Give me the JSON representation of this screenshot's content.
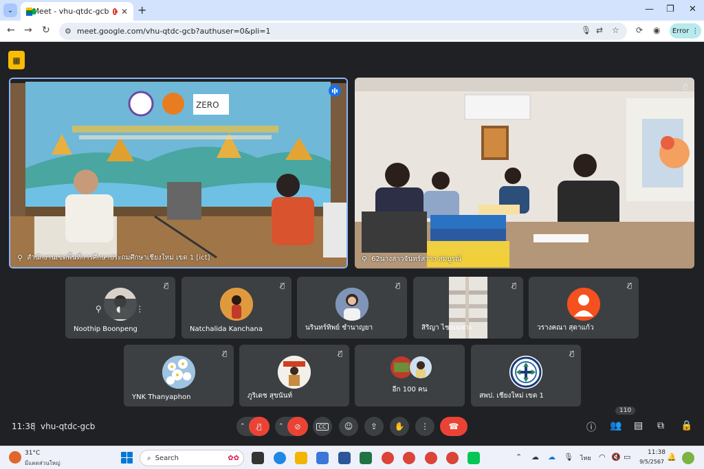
{
  "browser": {
    "tab_title": "Meet - vhu-qtdc-gcb",
    "url": "meet.google.com/vhu-qtdc-gcb?authuser=0&pli=1",
    "error_label": "Error"
  },
  "meeting": {
    "time": "11:38",
    "separator": "|",
    "code": "vhu-qtdc-gcb",
    "participant_count": "110"
  },
  "main_tiles": [
    {
      "name": "สำนักงานเขตพื้นที่การศึกษาประถมศึกษาเชียงใหม่ เขต 1 [ict]"
    },
    {
      "name": "62นางสาวจันทร์สว่าง สมบูรณ์"
    }
  ],
  "row1": [
    {
      "name": "Noothip Boonpeng"
    },
    {
      "name": "Natchalida Kanchana"
    },
    {
      "name": "นรินทร์ทิพย์ ชำนาญยา"
    },
    {
      "name": "สิริญา ไชยเฉพาะ"
    },
    {
      "name": "วรางคณา สุดาแก้ว"
    }
  ],
  "row2": [
    {
      "name": "YNK Thanyaphon"
    },
    {
      "name": "ภูริเดช สุขนันท์"
    },
    {
      "name": "อีก 100 คน"
    },
    {
      "name": "สพป. เชียงใหม่ เขต 1"
    }
  ],
  "taskbar": {
    "temperature": "31°C",
    "weather_desc": "มีแดดส่วนใหญ่",
    "search_placeholder": "Search",
    "lang": "ไทย",
    "time": "11:38",
    "date": "9/5/2567"
  },
  "colors": {
    "accent_blue": "#8ab4f8",
    "danger_red": "#ea4335",
    "tile_bg": "#3c4043",
    "meet_bg": "#202124",
    "avatar_orange": "#f4511e"
  }
}
